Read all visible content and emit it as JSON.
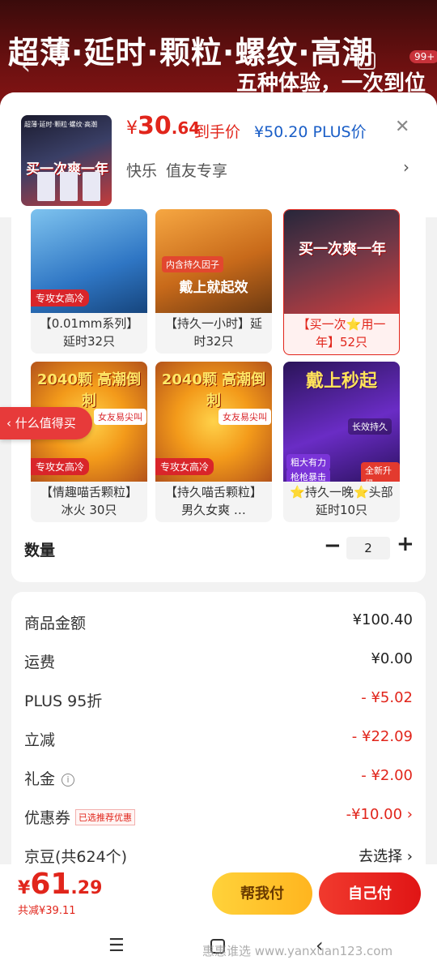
{
  "banner": {
    "line1": "超薄·延时·颗粒·螺纹·高潮",
    "line2": "五种体验，一次到位",
    "badge": "99+"
  },
  "product": {
    "thumb_top_text": "超薄·延时·颗粒·螺纹·高潮",
    "thumb_banner_text": "买一次爽一年",
    "price_symbol": "¥",
    "price_int": "30",
    "price_dec": ".64",
    "price_label": "到手价",
    "plus_price": "¥50.20 PLUS价",
    "tags": [
      "快乐",
      "值友专享"
    ]
  },
  "float_tab": "什么值得买",
  "variants": [
    {
      "label": "【0.01mm系列】延时32只",
      "caption": "专攻女高冷",
      "img_title": "",
      "selected": false
    },
    {
      "label": "【持久一小时】延时32只",
      "caption": "内含持久因子",
      "img_title": "戴上就起效",
      "selected": false
    },
    {
      "label": "【买一次⭐用一年】52只",
      "caption": "",
      "img_title": "买一次爽一年",
      "selected": true
    },
    {
      "label": "【情趣喵舌颗粒】冰火 30只",
      "caption": "专攻女高冷",
      "img_title": "2040颗 高潮倒刺",
      "img_sub": "女友易尖叫",
      "selected": false
    },
    {
      "label": "【持久喵舌颗粒】男久女爽 …",
      "caption": "专攻女高冷",
      "img_title": "2040颗 高潮倒刺",
      "img_sub": "女友易尖叫",
      "selected": false
    },
    {
      "label": "⭐持久一晚⭐头部延时10只",
      "caption": "",
      "img_title": "戴上秒起",
      "img_sub": "粗大有力",
      "img_sub2": "枪枪暴击",
      "img_badge": "全新升级",
      "img_text": "长效持久",
      "selected": false
    }
  ],
  "quantity": {
    "label": "数量",
    "minus": "−",
    "value": "2",
    "plus": "+"
  },
  "summary": {
    "rows": [
      {
        "key": "商品金额",
        "value": "¥100.40",
        "red": false
      },
      {
        "key": "运费",
        "value": "¥0.00",
        "red": false
      },
      {
        "key": "PLUS 95折",
        "value": "- ¥5.02",
        "red": true
      },
      {
        "key": "立减",
        "value": "- ¥22.09",
        "red": true
      },
      {
        "key": "礼金",
        "value": "- ¥2.00",
        "red": true
      },
      {
        "key": "优惠券",
        "value": "-¥10.00 ›",
        "red": true,
        "tag": "已选推荐优惠"
      },
      {
        "key": "京豆(共624个)",
        "value": "去选择 ›",
        "red": false
      }
    ]
  },
  "bottom": {
    "total_symbol": "¥",
    "total_int": "61",
    "total_dec": ".29",
    "saved": "共减¥39.11",
    "help_pay": "帮我付",
    "self_pay": "自己付"
  },
  "watermark": "惠惠谁选 www.yanxuan123.com",
  "colors": {
    "accent": "#e1251b",
    "plus_blue": "#1a5ec7",
    "help_btn": "#ffc22a"
  }
}
